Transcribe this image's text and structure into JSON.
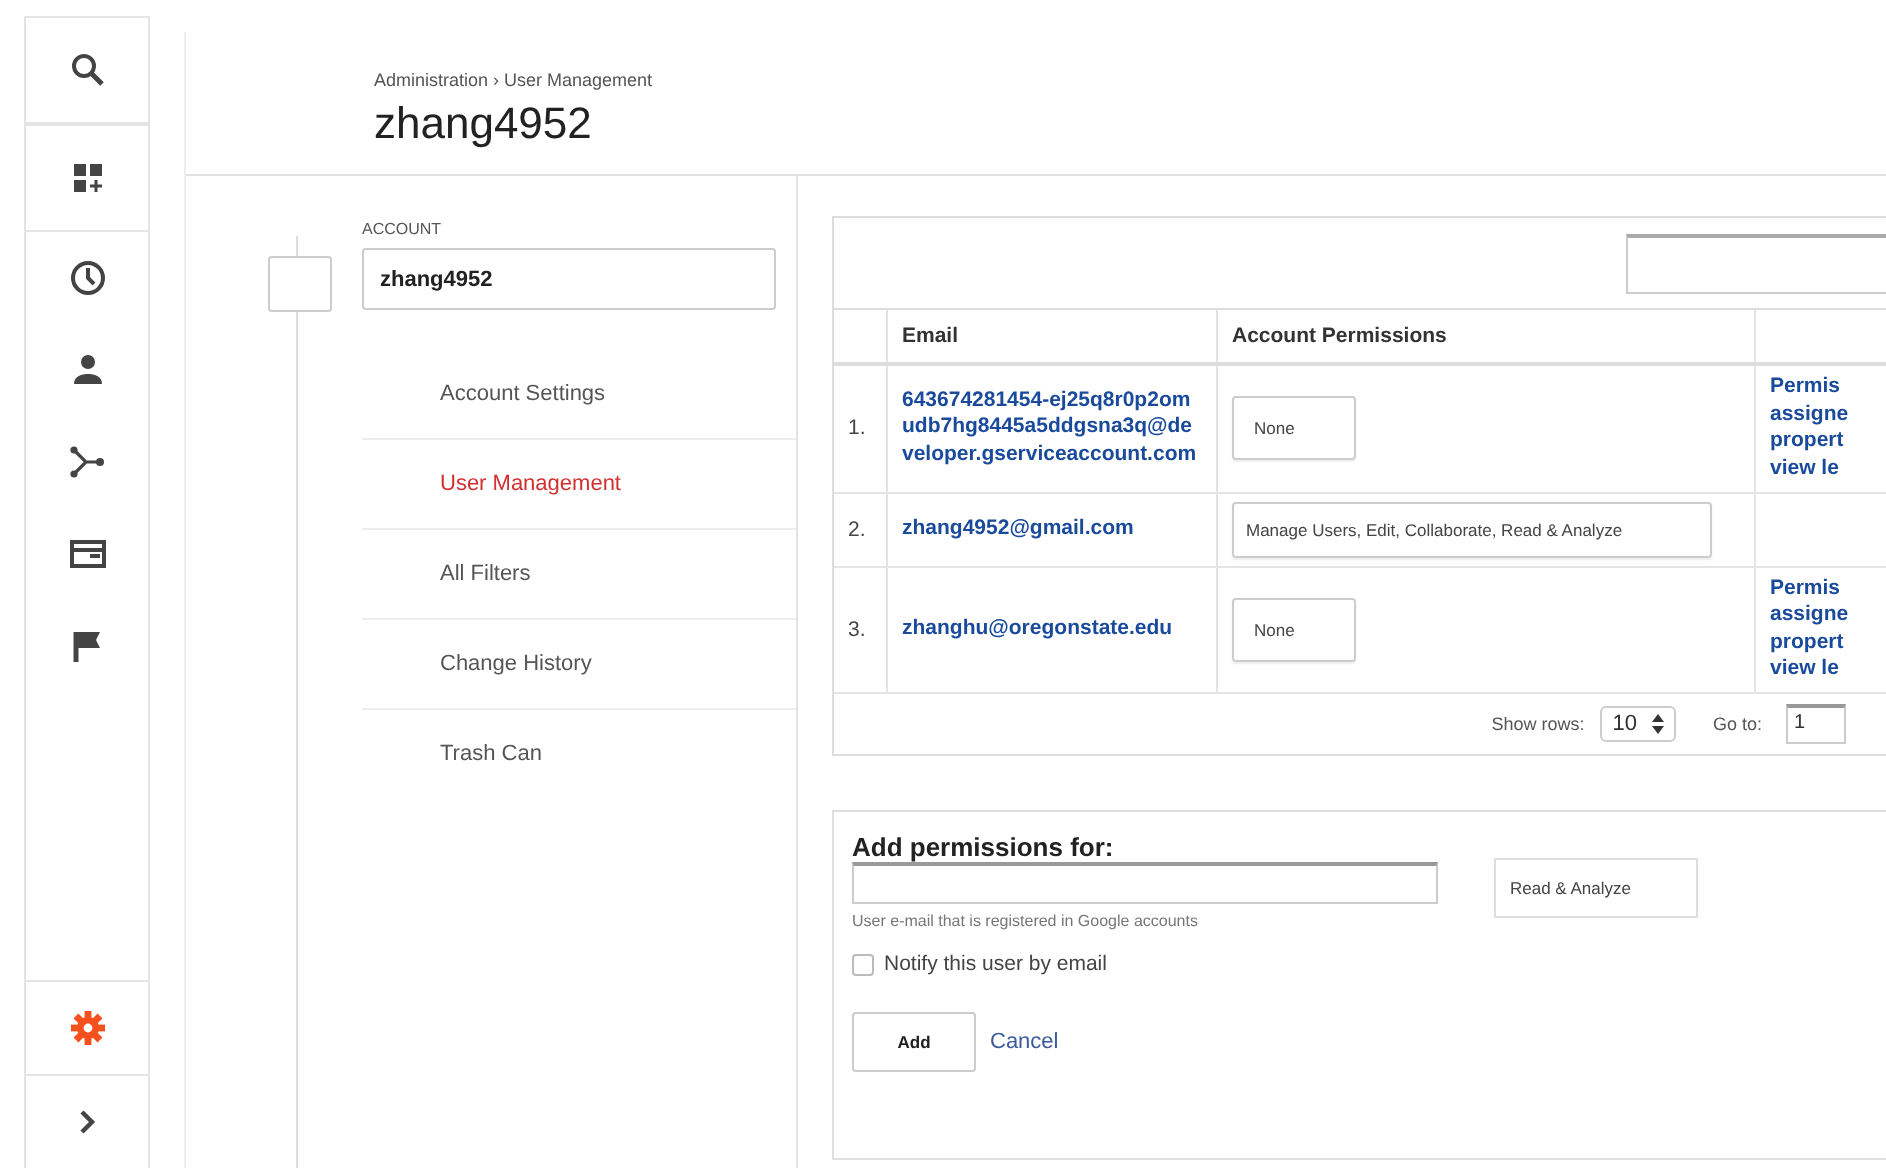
{
  "rail": [
    {
      "kind": "search",
      "selected": false
    },
    {
      "kind": "dashboard",
      "selected": false
    },
    {
      "kind": "clock",
      "selected": false
    },
    {
      "kind": "person",
      "selected": false
    },
    {
      "kind": "branch",
      "selected": false
    },
    {
      "kind": "window",
      "selected": false
    },
    {
      "kind": "flag",
      "selected": false
    },
    {
      "kind": "gear",
      "selected": true
    },
    {
      "kind": "chevron",
      "selected": false
    }
  ],
  "breadcrumb": "Administration › User Management",
  "title": "zhang4952",
  "account": {
    "label": "ACCOUNT",
    "value": "zhang4952"
  },
  "nav": [
    {
      "label": "Account Settings",
      "selected": false
    },
    {
      "label": "User Management",
      "selected": true
    },
    {
      "label": "All Filters",
      "selected": false
    },
    {
      "label": "Change History",
      "selected": false
    },
    {
      "label": "Trash Can",
      "selected": false
    }
  ],
  "table": {
    "columns": [
      "Email",
      "Account Permissions"
    ],
    "rows": [
      {
        "number": "1.",
        "email": "643674281454-ej25q8r0p2omudb7hg8445a5ddgsna3q@developer.gserviceaccount.com",
        "permissions": "None",
        "note": [
          "Permis",
          "assigne",
          "propert",
          "view le"
        ]
      },
      {
        "number": "2.",
        "email": "zhang4952@gmail.com",
        "permissions": "Manage Users, Edit, Collaborate, Read & Analyze",
        "note": []
      },
      {
        "number": "3.",
        "email": "zhanghu@oregonstate.edu",
        "permissions": "None",
        "note": [
          "Permis",
          "assigne",
          "propert",
          "view le"
        ]
      }
    ],
    "show_rows_label": "Show rows:",
    "show_rows": "10",
    "goto_label": "Go to:",
    "goto": "1"
  },
  "add": {
    "title": "Add permissions for:",
    "hint": "User e-mail that is registered in Google accounts",
    "permission": "Read & Analyze",
    "notify": {
      "label": "Notify this user by email",
      "checked": false
    },
    "add_button": "Add",
    "cancel": "Cancel"
  }
}
